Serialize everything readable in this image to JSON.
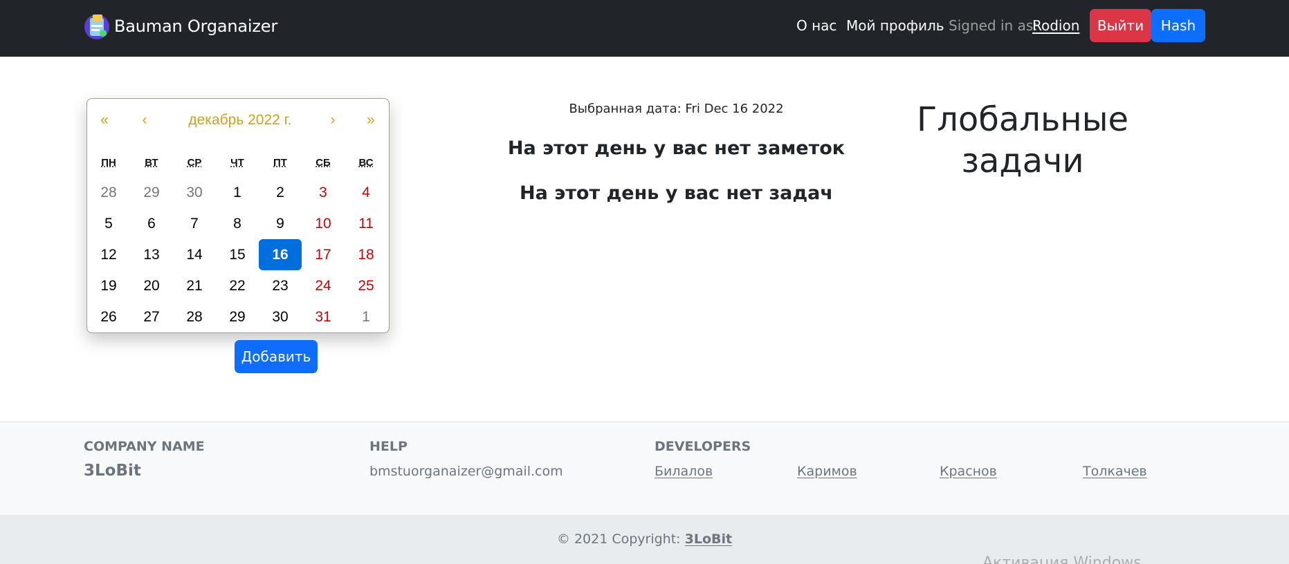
{
  "header": {
    "brand": "Bauman Organaizer",
    "nav": {
      "about": "О нас",
      "profile": "Мой профиль",
      "signed_in_label": "Signed in as:",
      "username": "Rodion"
    },
    "buttons": {
      "logout": "Выйти",
      "hash": "Hash"
    }
  },
  "calendar": {
    "nav": {
      "prev_year": "«",
      "prev_month": "‹",
      "month_label": "декабрь 2022 г.",
      "next_month": "›",
      "next_year": "»"
    },
    "weekdays": [
      "ПН",
      "ВТ",
      "СР",
      "ЧТ",
      "ПТ",
      "СБ",
      "ВС"
    ],
    "weeks": [
      [
        "28",
        "29",
        "30",
        "1",
        "2",
        "3",
        "4"
      ],
      [
        "5",
        "6",
        "7",
        "8",
        "9",
        "10",
        "11"
      ],
      [
        "12",
        "13",
        "14",
        "15",
        "16",
        "17",
        "18"
      ],
      [
        "19",
        "20",
        "21",
        "22",
        "23",
        "24",
        "25"
      ],
      [
        "26",
        "27",
        "28",
        "29",
        "30",
        "31",
        "1"
      ]
    ],
    "selected_day": "16",
    "colors": {
      "nav": "#d4a017",
      "selected": "#006edc",
      "weekend": "#d10000",
      "muted": "#757575"
    }
  },
  "actions": {
    "add": "Добавить"
  },
  "main": {
    "selected_date": "Выбранная дата: Fri Dec 16 2022",
    "no_notes": "На этот день у вас нет заметок",
    "no_tasks": "На этот день у вас нет задач"
  },
  "global_tasks": {
    "title_line1": "Глобальные",
    "title_line2": "задачи"
  },
  "footer": {
    "company": {
      "heading": "COMPANY NAME",
      "name": "3LoBit"
    },
    "help": {
      "heading": "HELP",
      "email": "bmstuorganaizer@gmail.com"
    },
    "developers": {
      "heading": "DEVELOPERS",
      "names": [
        "Билалов",
        "Каримов",
        "Краснов",
        "Толкачев"
      ]
    },
    "copyright_prefix": "© 2021 Copyright: ",
    "copyright_link": "3LoBit"
  },
  "overlay": {
    "watermark": "Активация Windows"
  }
}
